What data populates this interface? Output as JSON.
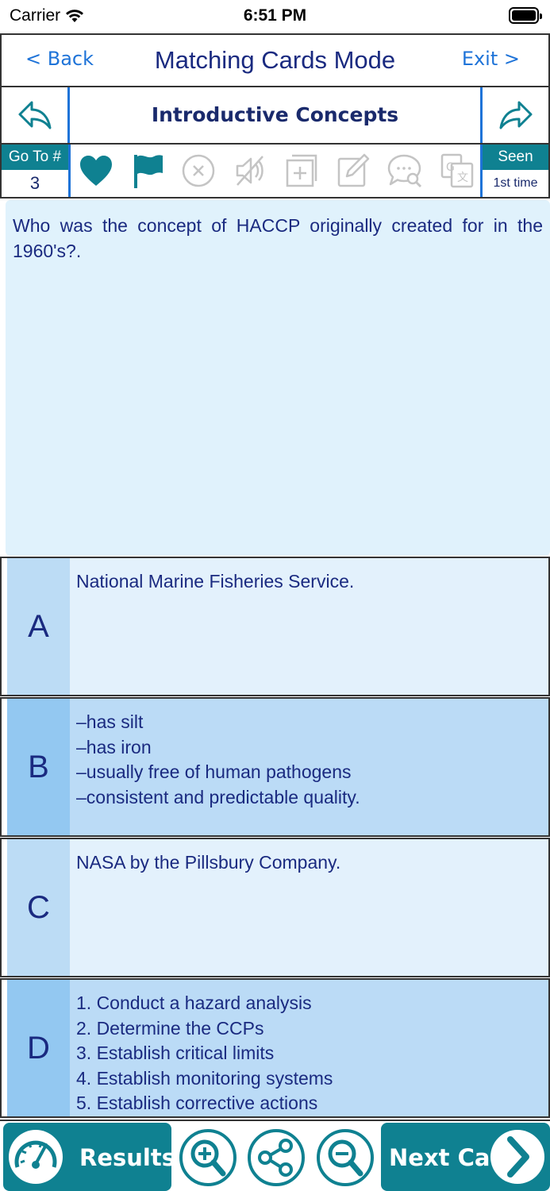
{
  "status_bar": {
    "carrier": "Carrier",
    "time": "6:51 PM"
  },
  "nav": {
    "back_label": "< Back",
    "title": "Matching Cards Mode",
    "exit_label": "Exit >"
  },
  "topic": {
    "title": "Introductive Concepts"
  },
  "toolbar": {
    "goto_label": "Go To #",
    "goto_value": "3",
    "seen_label": "Seen",
    "seen_value": "1st time",
    "icons": [
      "heart-icon",
      "flag-icon",
      "close-icon",
      "mute-icon",
      "add-icon",
      "edit-icon",
      "comment-search-icon",
      "translate-icon"
    ]
  },
  "question": {
    "text": "Who was the concept of HACCP originally created for in the 1960's?."
  },
  "answers": [
    {
      "letter": "A",
      "text": "National Marine Fisheries Service."
    },
    {
      "letter": "B",
      "text": "–has silt\n–has iron\n–usually free of human pathogens\n–consistent and predictable quality."
    },
    {
      "letter": "C",
      "text": "NASA by the Pillsbury Company."
    },
    {
      "letter": "D",
      "text": "1. Conduct a hazard analysis\n2. Determine the CCPs\n3. Establish critical limits\n4. Establish monitoring systems\n5. Establish corrective actions"
    }
  ],
  "bottom": {
    "results_label": "Results",
    "next_card_label": "Next Card"
  },
  "colors": {
    "teal": "#0f8191",
    "blue_link": "#1e73d8",
    "navy_text": "#1a2a80",
    "question_bg": "#e0f2fc"
  }
}
